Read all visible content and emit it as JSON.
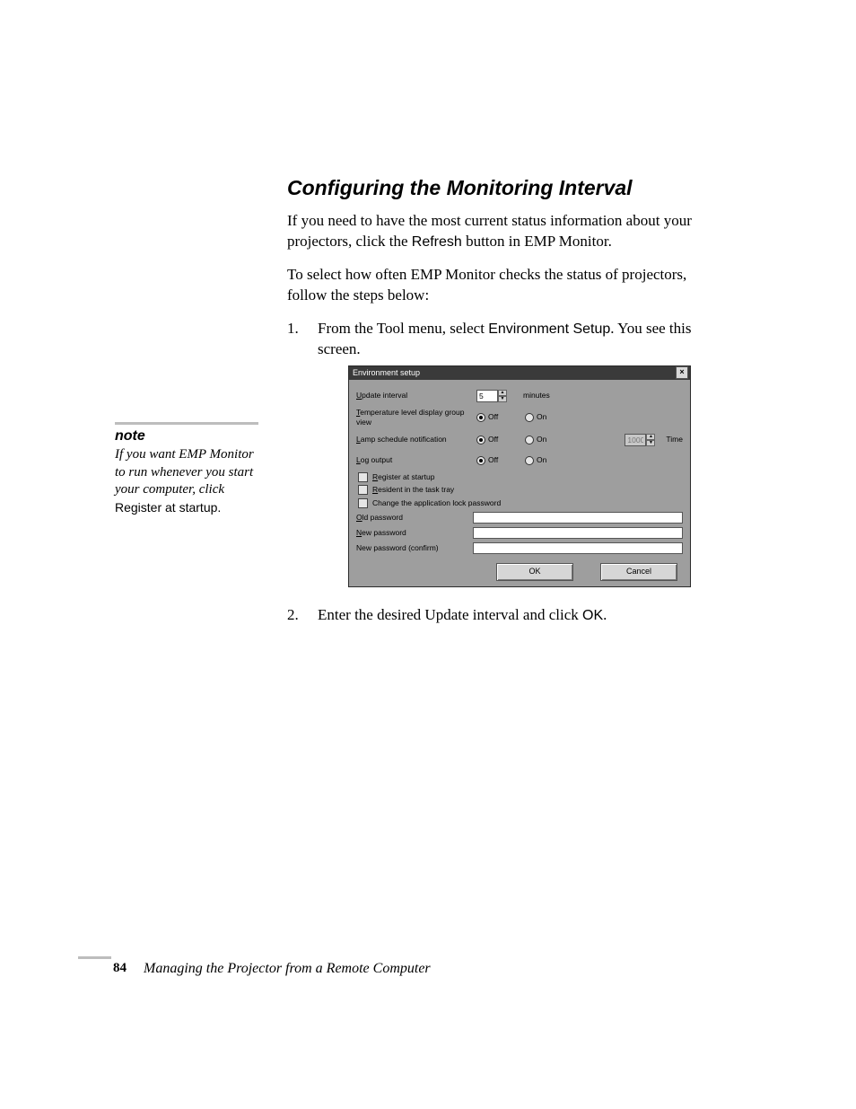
{
  "heading": "Configuring the Monitoring Interval",
  "para1_a": "If you need to have the most current status information about your projectors, click the ",
  "para1_b": "Refresh",
  "para1_c": " button in EMP Monitor.",
  "para2": "To select how often EMP Monitor checks the status of projectors, follow the steps below:",
  "step1_a": "From the Tool menu, select ",
  "step1_b": "Environment Setup",
  "step1_c": ". You see this screen.",
  "step2_a": "Enter the desired Update interval and click ",
  "step2_b": "OK",
  "step2_c": ".",
  "note": {
    "head": "note",
    "body_a": "If you want EMP Monitor to run whenever you start your computer, click ",
    "body_b": "Register at startup",
    "body_c": "."
  },
  "dialog": {
    "title": "Environment setup",
    "update_label": "Update interval",
    "update_value": "5",
    "minutes": "minutes",
    "temp_label": "Temperature level display group view",
    "lamp_label": "Lamp schedule notification",
    "lamp_time_value": "1000",
    "lamp_time_unit": "Time",
    "log_label": "Log output",
    "off": "Off",
    "on": "On",
    "chk_register": "Register at startup",
    "chk_resident": "Resident in the task tray",
    "chk_change_pw": "Change the application lock password",
    "old_pw": "Old password",
    "new_pw": "New password",
    "new_pw_confirm": "New password (confirm)",
    "ok": "OK",
    "cancel": "Cancel"
  },
  "footer": {
    "page": "84",
    "title": "Managing the Projector from a Remote Computer"
  }
}
